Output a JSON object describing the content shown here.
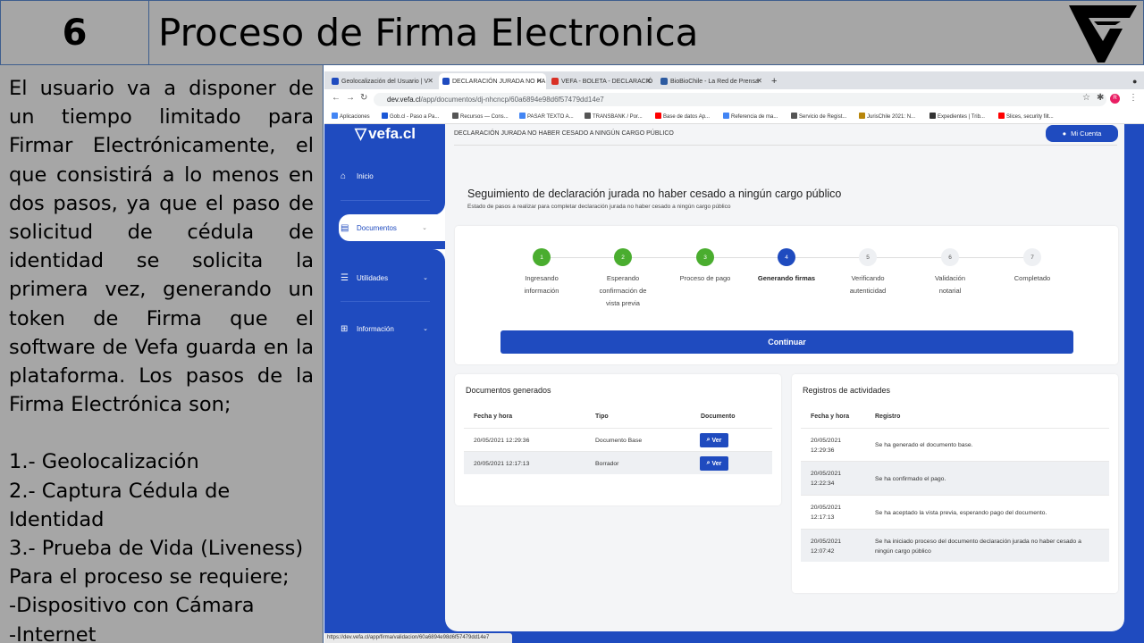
{
  "slide": {
    "number": "6",
    "title": "Proceso de Firma Electronica",
    "description": "El usuario va a disponer de un tiempo limitado para Firmar Electrónicamente, el que consistirá a lo menos en dos pasos, ya que el paso de solicitud de cédula de identidad se solicita la primera vez, generando un token de Firma que el software de Vefa guarda en la plataforma. Los pasos de la Firma Electrónica son;",
    "steps": [
      "1.- Geolocalización",
      "2.- Captura Cédula de Identidad",
      "3.- Prueba de Vida (Liveness)"
    ],
    "requirements_intro": "Para el proceso se requiere;",
    "requirements": [
      "-Dispositivo con Cámara",
      "-Internet"
    ]
  },
  "browser": {
    "tabs": [
      {
        "label": "Geolocalización del Usuario | V",
        "icon": "vefa-icon"
      },
      {
        "label": "DECLARACIÓN JURADA NO HA",
        "icon": "vefa-icon"
      },
      {
        "label": "VEFA - BOLETA - DECLARACIÓ",
        "icon": "gmail-icon"
      },
      {
        "label": "BioBioChile - La Red de Prensa",
        "icon": "biobio-icon"
      }
    ],
    "url_host": "dev.vefa.cl",
    "url_path": "/app/documentos/dj-nhcncp/60a6894e98d6f57479dd14e7",
    "bookmarks": [
      "Aplicaciones",
      "Gob.cl - Paso a Pa...",
      "Recursos — Cons...",
      "PASAR TEXTO A...",
      "TRANSBANK / Por...",
      "Base de datos Ap...",
      "Referencia de ma...",
      "Servicio de Regist...",
      "JurisChile 2021: N...",
      "Expedientes | Trib...",
      "Slices, security filt..."
    ],
    "status_url": "https://dev.vefa.cl/app/firma/validacion/60a6894e98d6f57479dd14e7"
  },
  "app": {
    "brand": "vefa.cl",
    "breadcrumb": "DECLARACIÓN JURADA NO HABER CESADO A NINGÚN CARGO PÚBLICO",
    "account_label": "Mi Cuenta",
    "nav": [
      {
        "label": "Inicio",
        "icon": "home-icon"
      },
      {
        "label": "Documentos",
        "icon": "archive-icon"
      },
      {
        "label": "Utilidades",
        "icon": "list-icon"
      },
      {
        "label": "Información",
        "icon": "info-plus-icon"
      }
    ],
    "page_title": "Seguimiento de declaración jurada no haber cesado a ningún cargo público",
    "page_subtitle": "Estado de pasos a realizar para completar declaración jurada no haber cesado a ningún cargo público",
    "progress_steps": [
      {
        "n": "1",
        "label1": "Ingresando",
        "label2": "información",
        "label3": "",
        "state": "done"
      },
      {
        "n": "2",
        "label1": "Esperando",
        "label2": "confirmación de",
        "label3": "vista previa",
        "state": "done"
      },
      {
        "n": "3",
        "label1": "Proceso de pago",
        "label2": "",
        "label3": "",
        "state": "done"
      },
      {
        "n": "4",
        "label1": "Generando firmas",
        "label2": "",
        "label3": "",
        "state": "current"
      },
      {
        "n": "5",
        "label1": "Verificando",
        "label2": "autenticidad",
        "label3": "",
        "state": "todo"
      },
      {
        "n": "6",
        "label1": "Validación",
        "label2": "notarial",
        "label3": "",
        "state": "todo"
      },
      {
        "n": "7",
        "label1": "Completado",
        "label2": "",
        "label3": "",
        "state": "todo"
      }
    ],
    "continue_label": "Continuar",
    "documents": {
      "title": "Documentos generados",
      "headers": [
        "Fecha y hora",
        "Tipo",
        "Documento"
      ],
      "rows": [
        {
          "date": "20/05/2021 12:29:36",
          "type": "Documento Base",
          "action": "Ver"
        },
        {
          "date": "20/05/2021 12:17:13",
          "type": "Borrador",
          "action": "Ver"
        }
      ]
    },
    "activity": {
      "title": "Registros de actividades",
      "headers": [
        "Fecha y hora",
        "Registro"
      ],
      "rows": [
        {
          "date": "20/05/2021",
          "time": "12:29:36",
          "text1": "Se ha generado el documento base.",
          "text2": ""
        },
        {
          "date": "20/05/2021",
          "time": "12:22:34",
          "text1": "Se ha confirmado el pago.",
          "text2": ""
        },
        {
          "date": "20/05/2021",
          "time": "12:17:13",
          "text1": "Se ha aceptado la vista previa, esperando pago del documento.",
          "text2": ""
        },
        {
          "date": "20/05/2021",
          "time": "12:07:42",
          "text1": "Se ha iniciado proceso del documento declaración jurada no haber cesado a",
          "text2": "ningún cargo público"
        }
      ]
    }
  },
  "colors": {
    "slide_bg": "#a6a6a6",
    "border": "#3e5e8e",
    "brand_blue": "#1f4bbf",
    "step_done": "#4aad2f"
  }
}
